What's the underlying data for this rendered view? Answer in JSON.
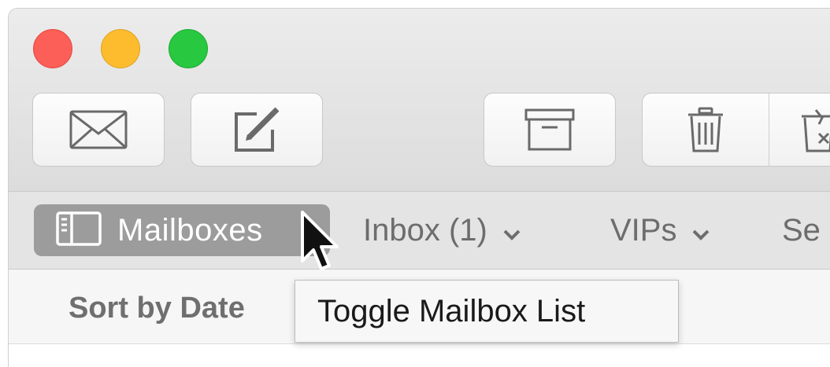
{
  "window": {
    "traffic_lights": [
      {
        "name": "close",
        "color": "#fc5f57"
      },
      {
        "name": "minimize",
        "color": "#fdbc2e"
      },
      {
        "name": "zoom",
        "color": "#28c840"
      }
    ]
  },
  "toolbar": {
    "buttons": [
      {
        "id": "get-mail",
        "icon": "envelope-icon"
      },
      {
        "id": "compose",
        "icon": "compose-icon"
      },
      {
        "id": "archive",
        "icon": "archive-box-icon"
      },
      {
        "id": "delete",
        "icon": "trash-icon"
      },
      {
        "id": "junk",
        "icon": "junk-icon"
      }
    ]
  },
  "favorites_bar": {
    "mailboxes_label": "Mailboxes",
    "mailboxes_icon": "sidebar-icon",
    "items": [
      {
        "label": "Inbox (1)",
        "icon": "chevron-down-icon"
      },
      {
        "label": "VIPs",
        "icon": "chevron-down-icon"
      },
      {
        "label": "Se"
      }
    ]
  },
  "message_list": {
    "sort_label": "Sort by Date"
  },
  "tooltip": {
    "text": "Toggle Mailbox List"
  },
  "colors": {
    "mailboxes_button_bg": "#9c9c9c",
    "toolbar_bg": "#e2e2e2"
  }
}
